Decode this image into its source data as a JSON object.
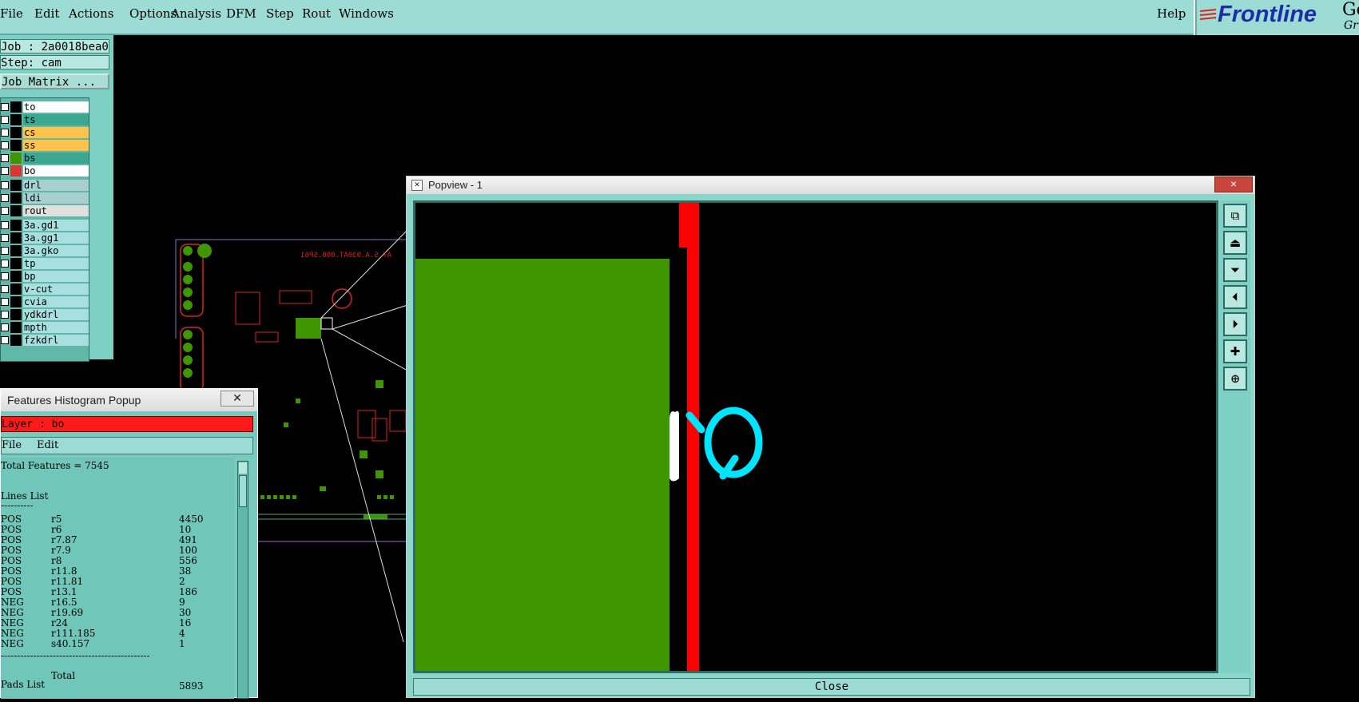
{
  "menubar": {
    "items": [
      "File",
      "Edit",
      "Actions",
      "Options",
      "Analysis",
      "DFM",
      "Step",
      "Rout",
      "Windows"
    ],
    "help": "Help"
  },
  "logo": {
    "brand": "Frontline",
    "partial1": "Ger",
    "partial2": "Gr"
  },
  "job": {
    "job_label": "Job : 2a0018bea0",
    "step_label": "Step: cam",
    "matrix_button": "Job Matrix ..."
  },
  "layers": [
    {
      "name": "to",
      "color": "#ffffff"
    },
    {
      "name": "ts",
      "color": "#3aa890"
    },
    {
      "name": "cs",
      "color": "#ffc24a"
    },
    {
      "name": "ss",
      "color": "#ffc24a"
    },
    {
      "name": "bs",
      "color": "#3aa890"
    },
    {
      "name": "bo",
      "color": "#ffffff"
    },
    {
      "name": "drl",
      "color": "#a8d0d0"
    },
    {
      "name": "ldi",
      "color": "#a8d0d0"
    },
    {
      "name": "rout",
      "color": "#e0e0e0"
    },
    {
      "name": "3a.gd1",
      "color": "#a8e0e0"
    },
    {
      "name": "3a.gg1",
      "color": "#a8e0e0"
    },
    {
      "name": "3a.gko",
      "color": "#a8e0e0"
    },
    {
      "name": "tp",
      "color": "#a8e0e0"
    },
    {
      "name": "bp",
      "color": "#a8e0e0"
    },
    {
      "name": "v-cut",
      "color": "#a8e0e0"
    },
    {
      "name": "cvia",
      "color": "#a8e0e0"
    },
    {
      "name": "ydkdrl",
      "color": "#a8e0e0"
    },
    {
      "name": "mpth",
      "color": "#a8e0e0"
    },
    {
      "name": "fzkdrl",
      "color": "#a8e0e0"
    }
  ],
  "histogram": {
    "title": "Features Histogram Popup",
    "layer_label": "Layer :  bo",
    "menu": [
      "File",
      "Edit"
    ],
    "total_features": "Total Features = 7545",
    "lines_list_title": "Lines List",
    "underline": "----------",
    "rows": [
      {
        "pol": "POS",
        "sym": "r5",
        "count": "4450"
      },
      {
        "pol": "POS",
        "sym": "r6",
        "count": "10"
      },
      {
        "pol": "POS",
        "sym": "r7.87",
        "count": "491"
      },
      {
        "pol": "POS",
        "sym": "r7.9",
        "count": "100"
      },
      {
        "pol": "POS",
        "sym": "r8",
        "count": "556"
      },
      {
        "pol": "POS",
        "sym": "r11.8",
        "count": "38"
      },
      {
        "pol": "POS",
        "sym": "r11.81",
        "count": "2"
      },
      {
        "pol": "POS",
        "sym": "r13.1",
        "count": "186"
      },
      {
        "pol": "NEG",
        "sym": "r16.5",
        "count": "9"
      },
      {
        "pol": "NEG",
        "sym": "r19.69",
        "count": "30"
      },
      {
        "pol": "NEG",
        "sym": "r24",
        "count": "16"
      },
      {
        "pol": "NEG",
        "sym": "r111.185",
        "count": "4"
      },
      {
        "pol": "NEG",
        "sym": "s40.157",
        "count": "1"
      }
    ],
    "separator": "----------------------------------------------",
    "total_label": "Total",
    "total_value": "5893",
    "pads_list_title": "Pads List"
  },
  "popview": {
    "title": "Popview - 1",
    "close_x": "×",
    "close_button": "Close",
    "tools": [
      "zoom-fit-icon",
      "up-icon",
      "down-icon",
      "left-icon",
      "right-icon",
      "zoom-in-icon",
      "zoom-out-icon"
    ]
  },
  "colors": {
    "copper": "#3f9600",
    "red": "#ff0000",
    "cyan": "#00e5ff",
    "white": "#ffffff",
    "panel": "#94d8d0"
  },
  "board_text": "AT.S.A.930AT.000.SP61"
}
